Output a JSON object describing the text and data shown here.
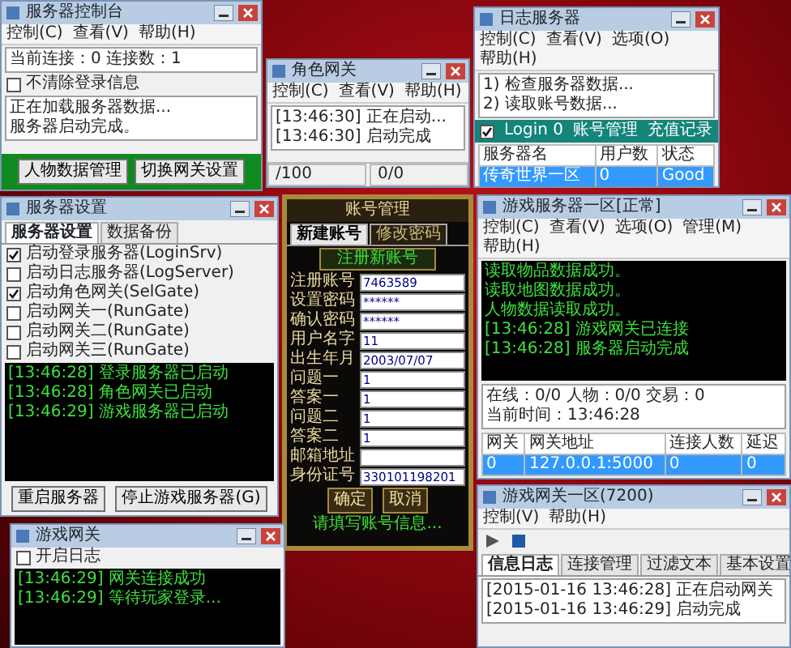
{
  "desktop": {
    "windows": [
      {
        "kind": "standard",
        "title": "服务器控制台",
        "menu": [
          "控制(C)",
          "查看(V)",
          "帮助(H)"
        ],
        "blocks": [
          {
            "kind": "lines",
            "lines": [
              "当前连接：0  连接数：1"
            ]
          },
          {
            "kind": "checks",
            "items": [
              {
                "label": "不清除登录信息",
                "checked": false
              }
            ]
          },
          {
            "kind": "lines",
            "lines": [
              "正在加载服务器数据...",
              "服务器启动完成。"
            ]
          },
          {
            "kind": "footer_buttons",
            "buttons": [
              "人物数据管理",
              "切换网关设置"
            ]
          }
        ]
      },
      {
        "kind": "standard",
        "title": "角色网关",
        "menu": [
          "控制(C)",
          "查看(V)",
          "帮助(H)"
        ],
        "blocks": [
          {
            "kind": "lines",
            "lines": [
              "[13:46:30] 正在启动...",
              "[13:46:30] 启动完成"
            ]
          },
          {
            "kind": "status",
            "cells": [
              "/100",
              "0/0"
            ]
          }
        ]
      },
      {
        "kind": "standard",
        "title": "日志服务器",
        "menu": [
          "控制(C)",
          "查看(V)",
          "选项(O)",
          "帮助(H)"
        ],
        "blocks": [
          {
            "kind": "lines",
            "lines": [
              "1) 检查服务器数据...",
              "2) 读取账号数据..."
            ]
          },
          {
            "kind": "strip",
            "checked": true,
            "items": [
              "Login 0",
              "账号管理",
              "充值记录"
            ]
          },
          {
            "kind": "table",
            "columns": [
              "服务器名",
              "用户数",
              "状态"
            ],
            "rows": [
              {
                "cells": [
                  "传奇世界一区",
                  "0",
                  "Good"
                ],
                "selected": true
              }
            ]
          }
        ]
      },
      {
        "kind": "standard",
        "title": "服务器设置",
        "blocks": [
          {
            "kind": "tabs",
            "items": [
              {
                "label": "服务器设置",
                "selected": true
              },
              {
                "label": "数据备份",
                "selected": false
              }
            ]
          },
          {
            "kind": "checks",
            "items": [
              {
                "label": "启动登录服务器(LoginSrv)",
                "checked": true
              },
              {
                "label": "启动日志服务器(LogServer)",
                "checked": false
              },
              {
                "label": "启动角色网关(SelGate)",
                "checked": true
              },
              {
                "label": "启动网关一(RunGate)",
                "checked": false
              },
              {
                "label": "启动网关二(RunGate)",
                "checked": false
              },
              {
                "label": "启动网关三(RunGate)",
                "checked": false
              }
            ]
          },
          {
            "kind": "log",
            "lines": [
              "[13:46:28] 登录服务器已启动",
              "[13:46:28] 角色网关已启动",
              "[13:46:29] 游戏服务器已启动"
            ]
          },
          {
            "kind": "buttons",
            "buttons": [
              "重启服务器",
              "停止游戏服务器(G)"
            ]
          }
        ]
      },
      {
        "kind": "ornate",
        "title": "账号管理",
        "blocks": [
          {
            "kind": "tabs",
            "items": [
              {
                "label": "新建账号",
                "selected": true
              },
              {
                "label": "修改密码",
                "selected": false
              }
            ]
          },
          {
            "kind": "heading",
            "text": "注册新账号"
          },
          {
            "kind": "form",
            "fields": [
              {
                "label": "注册账号",
                "value": "7463589"
              },
              {
                "label": "设置密码",
                "value": "******"
              },
              {
                "label": "确认密码",
                "value": "******"
              },
              {
                "label": "用户名字",
                "value": "11"
              },
              {
                "label": "出生年月",
                "value": "2003/07/07"
              },
              {
                "label": "问题一",
                "value": "1"
              },
              {
                "label": "答案一",
                "value": "1"
              },
              {
                "label": "问题二",
                "value": "1"
              },
              {
                "label": "答案二",
                "value": "1"
              },
              {
                "label": "邮箱地址"
              },
              {
                "label": "身份证号",
                "value": "330101198201"
              }
            ]
          },
          {
            "kind": "buttons",
            "buttons": [
              "确定",
              "取消"
            ]
          },
          {
            "kind": "notice",
            "text": "请填写账号信息..."
          }
        ]
      },
      {
        "kind": "standard",
        "title": "游戏服务器一区[正常]",
        "menu": [
          "控制(C)",
          "查看(V)",
          "选项(O)",
          "管理(M)",
          "帮助(H)"
        ],
        "blocks": [
          {
            "kind": "log",
            "lines": [
              "读取物品数据成功。",
              "读取地图数据成功。",
              "人物数据读取成功。",
              "[13:46:28] 游戏网关已连接",
              "[13:46:28] 服务器启动完成"
            ]
          },
          {
            "kind": "lines",
            "lines": [
              "在线：0/0  人物：0/0  交易：0",
              "当前时间：13:46:28"
            ]
          },
          {
            "kind": "table",
            "columns": [
              "网关",
              "网关地址",
              "连接人数",
              "延迟"
            ],
            "rows": [
              {
                "cells": [
                  "0",
                  "127.0.0.1:5000",
                  "0",
                  "0"
                ],
                "selected": true
              }
            ]
          }
        ]
      },
      {
        "kind": "standard",
        "title": "游戏网关一区(7200)",
        "menu": [
          "控制(V)",
          "帮助(H)"
        ],
        "blocks": [
          {
            "kind": "media"
          },
          {
            "kind": "tabs",
            "items": [
              {
                "label": "信息日志",
                "selected": true
              },
              {
                "label": "连接管理",
                "selected": false
              },
              {
                "label": "过滤文本",
                "selected": false
              },
              {
                "label": "基本设置",
                "selected": false
              }
            ]
          },
          {
            "kind": "lines",
            "lines": [
              "[2015-01-16 13:46:28] 正在启动网关",
              "[2015-01-16 13:46:29] 启动完成"
            ]
          }
        ]
      },
      {
        "kind": "standard",
        "title": "游戏网关",
        "blocks": [
          {
            "kind": "checks",
            "items": [
              {
                "label": "开启日志",
                "checked": false
              }
            ]
          },
          {
            "kind": "log",
            "lines": [
              "[13:46:29] 网关连接成功",
              "[13:46:29] 等待玩家登录..."
            ]
          }
        ]
      }
    ]
  }
}
